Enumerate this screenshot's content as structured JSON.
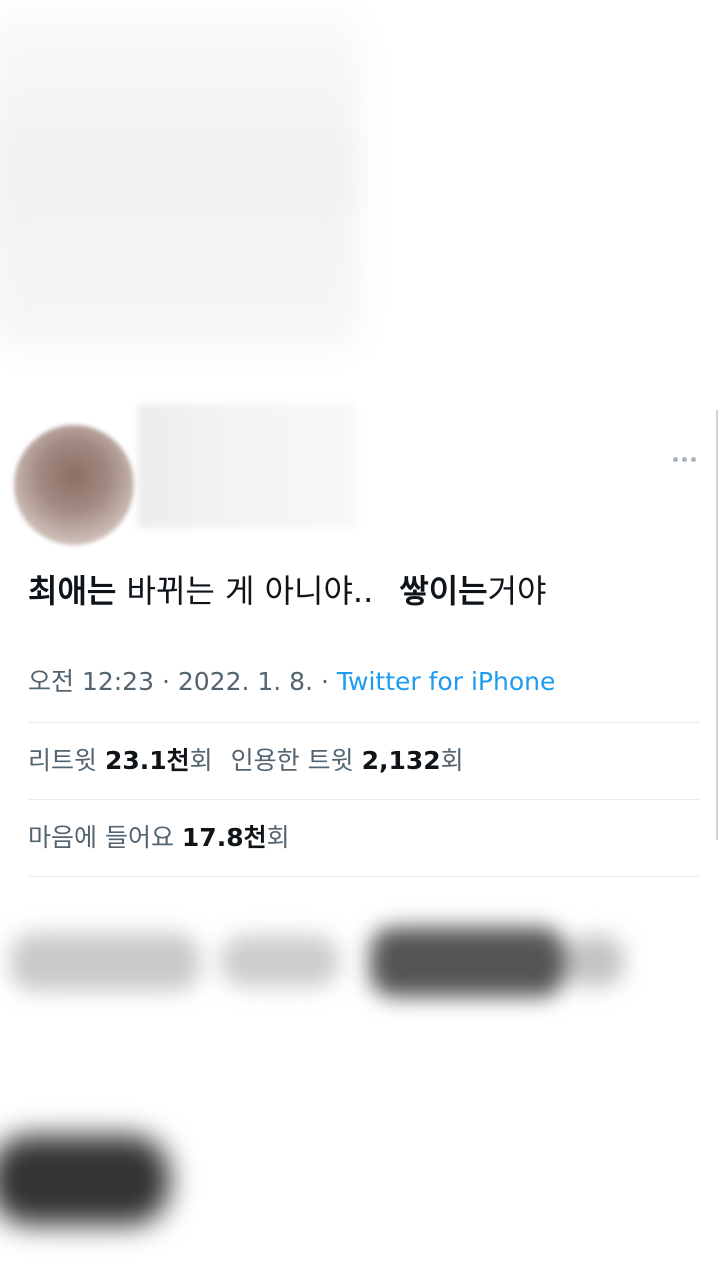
{
  "tweet": {
    "text_segments": [
      {
        "text": "최애는",
        "bold": true
      },
      {
        "text": " 바뀌는 게 아니야..",
        "bold": false
      },
      {
        "text": "쌓이는",
        "bold": true
      },
      {
        "text": "거야",
        "bold": false
      }
    ],
    "time": "오전 12:23",
    "date": "2022. 1. 8.",
    "separator": "·",
    "source": "Twitter for iPhone"
  },
  "stats": {
    "retweets_label": "리트윗",
    "retweets_value": "23.1천",
    "retweets_unit": "회",
    "quotes_label": "인용한 트윗",
    "quotes_value": "2,132",
    "quotes_unit": "회",
    "likes_label": "마음에 들어요",
    "likes_value": "17.8천",
    "likes_unit": "회"
  },
  "icons": {
    "more": "more-horizontal-icon"
  }
}
